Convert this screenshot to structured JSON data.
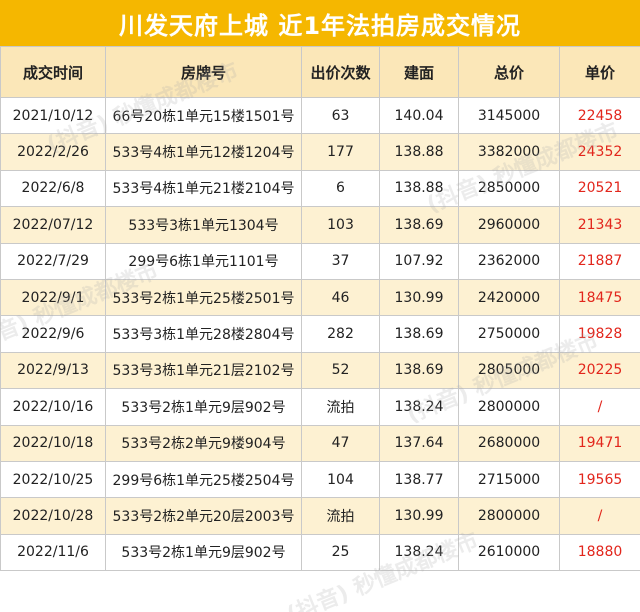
{
  "title": "川发天府上城 近1年法拍房成交情况",
  "watermark": "(抖音) 秒懂成都楼市",
  "colors": {
    "title_bg": "#f5b700",
    "header_bg": "#fbe7b8",
    "stripe_bg": "#fdf1d2",
    "unit_price": "#e2261c"
  },
  "table": {
    "headers": [
      "成交时间",
      "房牌号",
      "出价次数",
      "建面",
      "总价",
      "单价"
    ],
    "rows": [
      [
        "2021/10/12",
        "66号20栋1单元15楼1501号",
        "63",
        "140.04",
        "3145000",
        "22458"
      ],
      [
        "2022/2/26",
        "533号4栋1单元12楼1204号",
        "177",
        "138.88",
        "3382000",
        "24352"
      ],
      [
        "2022/6/8",
        "533号4栋1单元21楼2104号",
        "6",
        "138.88",
        "2850000",
        "20521"
      ],
      [
        "2022/07/12",
        "533号3栋1单元1304号",
        "103",
        "138.69",
        "2960000",
        "21343"
      ],
      [
        "2022/7/29",
        "299号6栋1单元1101号",
        "37",
        "107.92",
        "2362000",
        "21887"
      ],
      [
        "2022/9/1",
        "533号2栋1单元25楼2501号",
        "46",
        "130.99",
        "2420000",
        "18475"
      ],
      [
        "2022/9/6",
        "533号3栋1单元28楼2804号",
        "282",
        "138.69",
        "2750000",
        "19828"
      ],
      [
        "2022/9/13",
        "533号3栋1单元21层2102号",
        "52",
        "138.69",
        "2805000",
        "20225"
      ],
      [
        "2022/10/16",
        "533号2栋1单元9层902号",
        "流拍",
        "138.24",
        "2800000",
        "/"
      ],
      [
        "2022/10/18",
        "533号2栋2单元9楼904号",
        "47",
        "137.64",
        "2680000",
        "19471"
      ],
      [
        "2022/10/25",
        "299号6栋1单元25楼2504号",
        "104",
        "138.77",
        "2715000",
        "19565"
      ],
      [
        "2022/10/28",
        "533号2栋2单元20层2003号",
        "流拍",
        "130.99",
        "2800000",
        "/"
      ],
      [
        "2022/11/6",
        "533号2栋1单元9层902号",
        "25",
        "138.24",
        "2610000",
        "18880"
      ]
    ]
  }
}
